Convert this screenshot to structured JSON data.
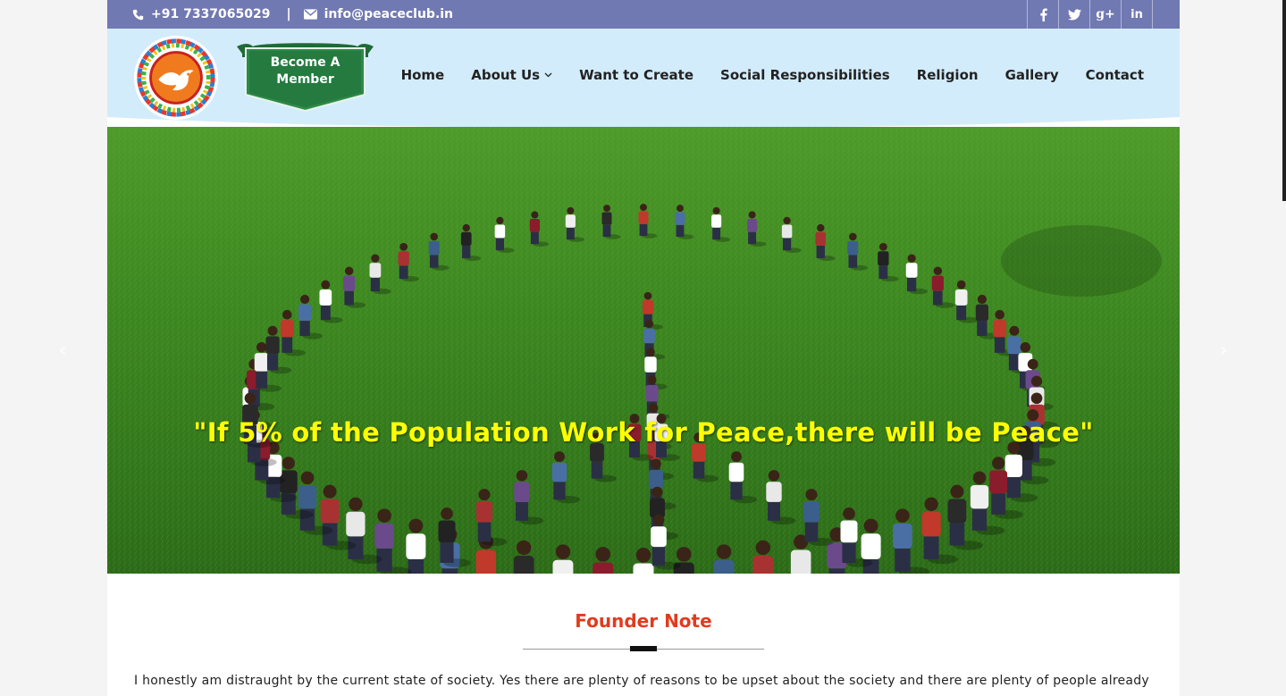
{
  "topbar": {
    "phone": "+91 7337065029",
    "separator": "|",
    "email": "info@peaceclub.in",
    "social": [
      {
        "icon": "facebook-icon",
        "glyph": "f"
      },
      {
        "icon": "twitter-icon",
        "glyph": "t"
      },
      {
        "icon": "google-plus-icon",
        "glyph": "g+"
      },
      {
        "icon": "linkedin-icon",
        "glyph": "in"
      }
    ]
  },
  "header": {
    "member_line1": "Become A",
    "member_line2": "Member"
  },
  "nav": {
    "home": "Home",
    "about": "About Us",
    "about_chevron": "⌄",
    "create": "Want to Create",
    "social": "Social Responsibilities",
    "religion": "Religion",
    "gallery": "Gallery",
    "contact": "Contact"
  },
  "hero": {
    "quote": "\"If 5% of the Population Work for Peace,there will be Peace\"",
    "prev": "‹",
    "next": "›"
  },
  "content": {
    "title": "Founder Note",
    "paragraph": "I honestly am distraught by the current state of society. Yes there are plenty of reasons to be upset about the society and there are plenty of people already"
  },
  "colors": {
    "topbar": "#7179b2",
    "header": "#d3ecfb",
    "accent": "#e03c1f",
    "quote": "#ffff00"
  }
}
